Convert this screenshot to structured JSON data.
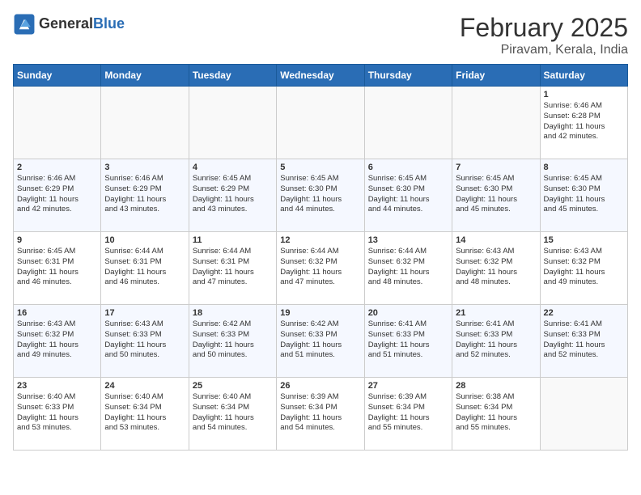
{
  "header": {
    "logo_general": "General",
    "logo_blue": "Blue",
    "month_title": "February 2025",
    "location": "Piravam, Kerala, India"
  },
  "days_of_week": [
    "Sunday",
    "Monday",
    "Tuesday",
    "Wednesday",
    "Thursday",
    "Friday",
    "Saturday"
  ],
  "weeks": [
    [
      {
        "day": "",
        "info": ""
      },
      {
        "day": "",
        "info": ""
      },
      {
        "day": "",
        "info": ""
      },
      {
        "day": "",
        "info": ""
      },
      {
        "day": "",
        "info": ""
      },
      {
        "day": "",
        "info": ""
      },
      {
        "day": "1",
        "info": "Sunrise: 6:46 AM\nSunset: 6:28 PM\nDaylight: 11 hours\nand 42 minutes."
      }
    ],
    [
      {
        "day": "2",
        "info": "Sunrise: 6:46 AM\nSunset: 6:29 PM\nDaylight: 11 hours\nand 42 minutes."
      },
      {
        "day": "3",
        "info": "Sunrise: 6:46 AM\nSunset: 6:29 PM\nDaylight: 11 hours\nand 43 minutes."
      },
      {
        "day": "4",
        "info": "Sunrise: 6:45 AM\nSunset: 6:29 PM\nDaylight: 11 hours\nand 43 minutes."
      },
      {
        "day": "5",
        "info": "Sunrise: 6:45 AM\nSunset: 6:30 PM\nDaylight: 11 hours\nand 44 minutes."
      },
      {
        "day": "6",
        "info": "Sunrise: 6:45 AM\nSunset: 6:30 PM\nDaylight: 11 hours\nand 44 minutes."
      },
      {
        "day": "7",
        "info": "Sunrise: 6:45 AM\nSunset: 6:30 PM\nDaylight: 11 hours\nand 45 minutes."
      },
      {
        "day": "8",
        "info": "Sunrise: 6:45 AM\nSunset: 6:30 PM\nDaylight: 11 hours\nand 45 minutes."
      }
    ],
    [
      {
        "day": "9",
        "info": "Sunrise: 6:45 AM\nSunset: 6:31 PM\nDaylight: 11 hours\nand 46 minutes."
      },
      {
        "day": "10",
        "info": "Sunrise: 6:44 AM\nSunset: 6:31 PM\nDaylight: 11 hours\nand 46 minutes."
      },
      {
        "day": "11",
        "info": "Sunrise: 6:44 AM\nSunset: 6:31 PM\nDaylight: 11 hours\nand 47 minutes."
      },
      {
        "day": "12",
        "info": "Sunrise: 6:44 AM\nSunset: 6:32 PM\nDaylight: 11 hours\nand 47 minutes."
      },
      {
        "day": "13",
        "info": "Sunrise: 6:44 AM\nSunset: 6:32 PM\nDaylight: 11 hours\nand 48 minutes."
      },
      {
        "day": "14",
        "info": "Sunrise: 6:43 AM\nSunset: 6:32 PM\nDaylight: 11 hours\nand 48 minutes."
      },
      {
        "day": "15",
        "info": "Sunrise: 6:43 AM\nSunset: 6:32 PM\nDaylight: 11 hours\nand 49 minutes."
      }
    ],
    [
      {
        "day": "16",
        "info": "Sunrise: 6:43 AM\nSunset: 6:32 PM\nDaylight: 11 hours\nand 49 minutes."
      },
      {
        "day": "17",
        "info": "Sunrise: 6:43 AM\nSunset: 6:33 PM\nDaylight: 11 hours\nand 50 minutes."
      },
      {
        "day": "18",
        "info": "Sunrise: 6:42 AM\nSunset: 6:33 PM\nDaylight: 11 hours\nand 50 minutes."
      },
      {
        "day": "19",
        "info": "Sunrise: 6:42 AM\nSunset: 6:33 PM\nDaylight: 11 hours\nand 51 minutes."
      },
      {
        "day": "20",
        "info": "Sunrise: 6:41 AM\nSunset: 6:33 PM\nDaylight: 11 hours\nand 51 minutes."
      },
      {
        "day": "21",
        "info": "Sunrise: 6:41 AM\nSunset: 6:33 PM\nDaylight: 11 hours\nand 52 minutes."
      },
      {
        "day": "22",
        "info": "Sunrise: 6:41 AM\nSunset: 6:33 PM\nDaylight: 11 hours\nand 52 minutes."
      }
    ],
    [
      {
        "day": "23",
        "info": "Sunrise: 6:40 AM\nSunset: 6:33 PM\nDaylight: 11 hours\nand 53 minutes."
      },
      {
        "day": "24",
        "info": "Sunrise: 6:40 AM\nSunset: 6:34 PM\nDaylight: 11 hours\nand 53 minutes."
      },
      {
        "day": "25",
        "info": "Sunrise: 6:40 AM\nSunset: 6:34 PM\nDaylight: 11 hours\nand 54 minutes."
      },
      {
        "day": "26",
        "info": "Sunrise: 6:39 AM\nSunset: 6:34 PM\nDaylight: 11 hours\nand 54 minutes."
      },
      {
        "day": "27",
        "info": "Sunrise: 6:39 AM\nSunset: 6:34 PM\nDaylight: 11 hours\nand 55 minutes."
      },
      {
        "day": "28",
        "info": "Sunrise: 6:38 AM\nSunset: 6:34 PM\nDaylight: 11 hours\nand 55 minutes."
      },
      {
        "day": "",
        "info": ""
      }
    ]
  ]
}
